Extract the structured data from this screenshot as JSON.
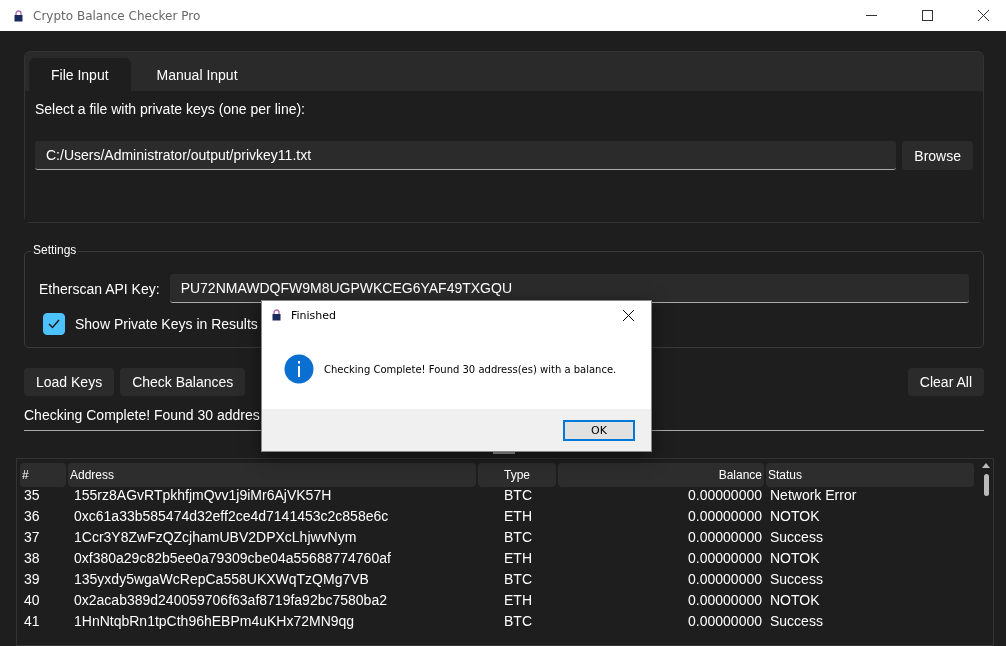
{
  "window": {
    "title": "Crypto Balance Checker Pro"
  },
  "tabs": [
    {
      "label": "File Input",
      "selected": true
    },
    {
      "label": "Manual Input",
      "selected": false
    }
  ],
  "file_input": {
    "prompt": "Select a file with private keys (one per line):",
    "path": "C:/Users/Administrator/output/privkey11.txt",
    "browse_button": "Browse"
  },
  "settings": {
    "title": "Settings",
    "api_key_label": "Etherscan API Key:",
    "api_key": "PU72NMAWDQFW9M8UGPWKCEG6YAF49TXGQU",
    "show_keys": {
      "label": "Show Private Keys in Results",
      "checked": true
    }
  },
  "buttons": [
    "Load Keys",
    "Check Balances"
  ],
  "clear_button": "Clear All",
  "status": "Checking Complete! Found 30 addres",
  "table": {
    "columns": [
      "#",
      "Address",
      "Type",
      "Balance",
      "Status"
    ],
    "rows": [
      [
        "35",
        "155rz8AGvRTpkhfjmQvv1j9iMr6AjVK57H",
        "BTC",
        "0.00000000",
        "Network Error"
      ],
      [
        "36",
        "0xc61a33b585474d32eff2ce4d7141453c2c858e6c",
        "ETH",
        "0.00000000",
        "NOTOK"
      ],
      [
        "37",
        "1Ccr3Y8ZwFzQZcjhamUBV2DPXcLhjwvNym",
        "BTC",
        "0.00000000",
        "Success"
      ],
      [
        "38",
        "0xf380a29c82b5ee0a79309cbe04a55688774760af",
        "ETH",
        "0.00000000",
        "NOTOK"
      ],
      [
        "39",
        "135yxdy5wgaWcRepCa558UKXWqTzQMg7VB",
        "BTC",
        "0.00000000",
        "Success"
      ],
      [
        "40",
        "0x2acab389d240059706f63af8719fa92bc7580ba2",
        "ETH",
        "0.00000000",
        "NOTOK"
      ],
      [
        "41",
        "1HnNtqbRn1tpCth96hEBPm4uKHx72MN9qg",
        "BTC",
        "0.00000000",
        "Success"
      ]
    ]
  },
  "dialog": {
    "title": "Finished",
    "message": "Checking Complete! Found 30 address(es) with a balance.",
    "ok_button": "OK"
  }
}
